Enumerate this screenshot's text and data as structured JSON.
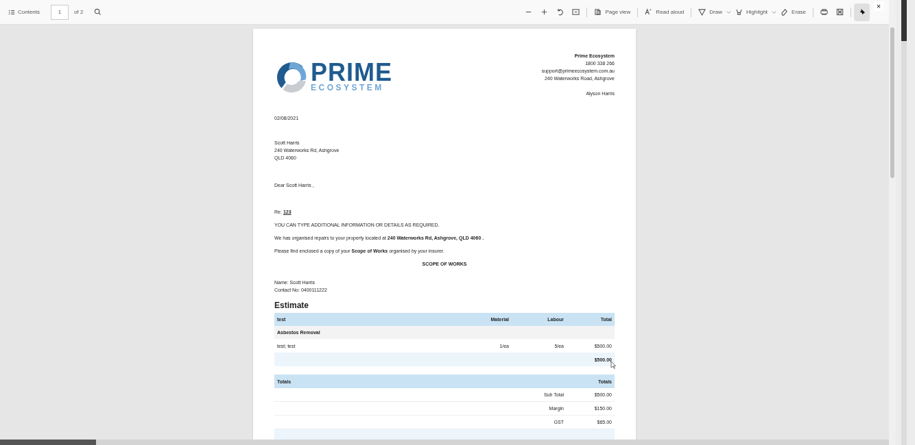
{
  "toolbar": {
    "contents_label": "Contents",
    "page_number": "1",
    "page_count": "of 2",
    "tools": [
      {
        "kind": "zoom-out",
        "pressed": false
      },
      {
        "kind": "zoom-in",
        "pressed": false
      },
      {
        "kind": "rotate",
        "pressed": false
      },
      {
        "kind": "fit",
        "pressed": false
      },
      {
        "kind": "page-view",
        "label": "Page view",
        "pressed": false
      },
      {
        "kind": "read-aloud",
        "label": "Read aloud",
        "pressed": false
      },
      {
        "kind": "draw",
        "label": "Draw",
        "pressed": false
      },
      {
        "kind": "highlight",
        "label": "Highlight",
        "pressed": false
      },
      {
        "kind": "erase",
        "label": "Erase",
        "pressed": false
      },
      {
        "kind": "print",
        "pressed": false
      },
      {
        "kind": "save",
        "pressed": false
      },
      {
        "kind": "pin",
        "pressed": true
      }
    ],
    "close": "×"
  },
  "document": {
    "logo": {
      "primary": "PRIME",
      "secondary": "ECOSYSTEM"
    },
    "sender": {
      "name": "Prime Ecosystem",
      "phone": "1800 338 266",
      "email": "support@primeecosystem.com.au",
      "address": "240 Waterworks Road, Ashgrove",
      "contact_person": "Alyson Harris"
    },
    "date": "02/08/2021",
    "recipient_lines": [
      "Scott Harris",
      "240 Waterworks Rd, Ashgrove",
      "QLD 4060"
    ],
    "salutation": "Dear Scott Harris ,",
    "re_label": "Re:",
    "re_value": "123",
    "paragraphs": [
      "YOU CAN TYPE ADDITIONAL INFORMATION OR DETAILS AS REQUIRED.",
      "We has organised repairs to your property located at **240 Waterworks Rd, Ashgrove, QLD 4060 .**",
      "Please find enclosed a copy of your **Scope of Works** organised by your insurer."
    ],
    "section_title": "SCOPE OF WORKS",
    "name_line": "Name: Scott Harris",
    "contact_line": "Contact No: 0400111222",
    "estimate_title": "Estimate",
    "estimate_table": {
      "columns": [
        "test",
        "Material",
        "Labour",
        "Total"
      ],
      "rows": [
        {
          "kind": "group",
          "cells": [
            "Asbestos Removal"
          ]
        },
        {
          "kind": "item",
          "cells": [
            "test; test",
            "1/ea",
            "5/ea",
            "$500.00"
          ]
        },
        {
          "kind": "subtotal",
          "cells": [
            "",
            "",
            "",
            "$500.00"
          ]
        }
      ]
    },
    "totals_table": {
      "columns": [
        "Totals",
        "Totals"
      ],
      "rows": [
        {
          "label": "Sub Total",
          "value": "$500.00"
        },
        {
          "label": "Margin",
          "value": "$150.00"
        },
        {
          "label": "GST",
          "value": "$65.00"
        }
      ]
    }
  }
}
